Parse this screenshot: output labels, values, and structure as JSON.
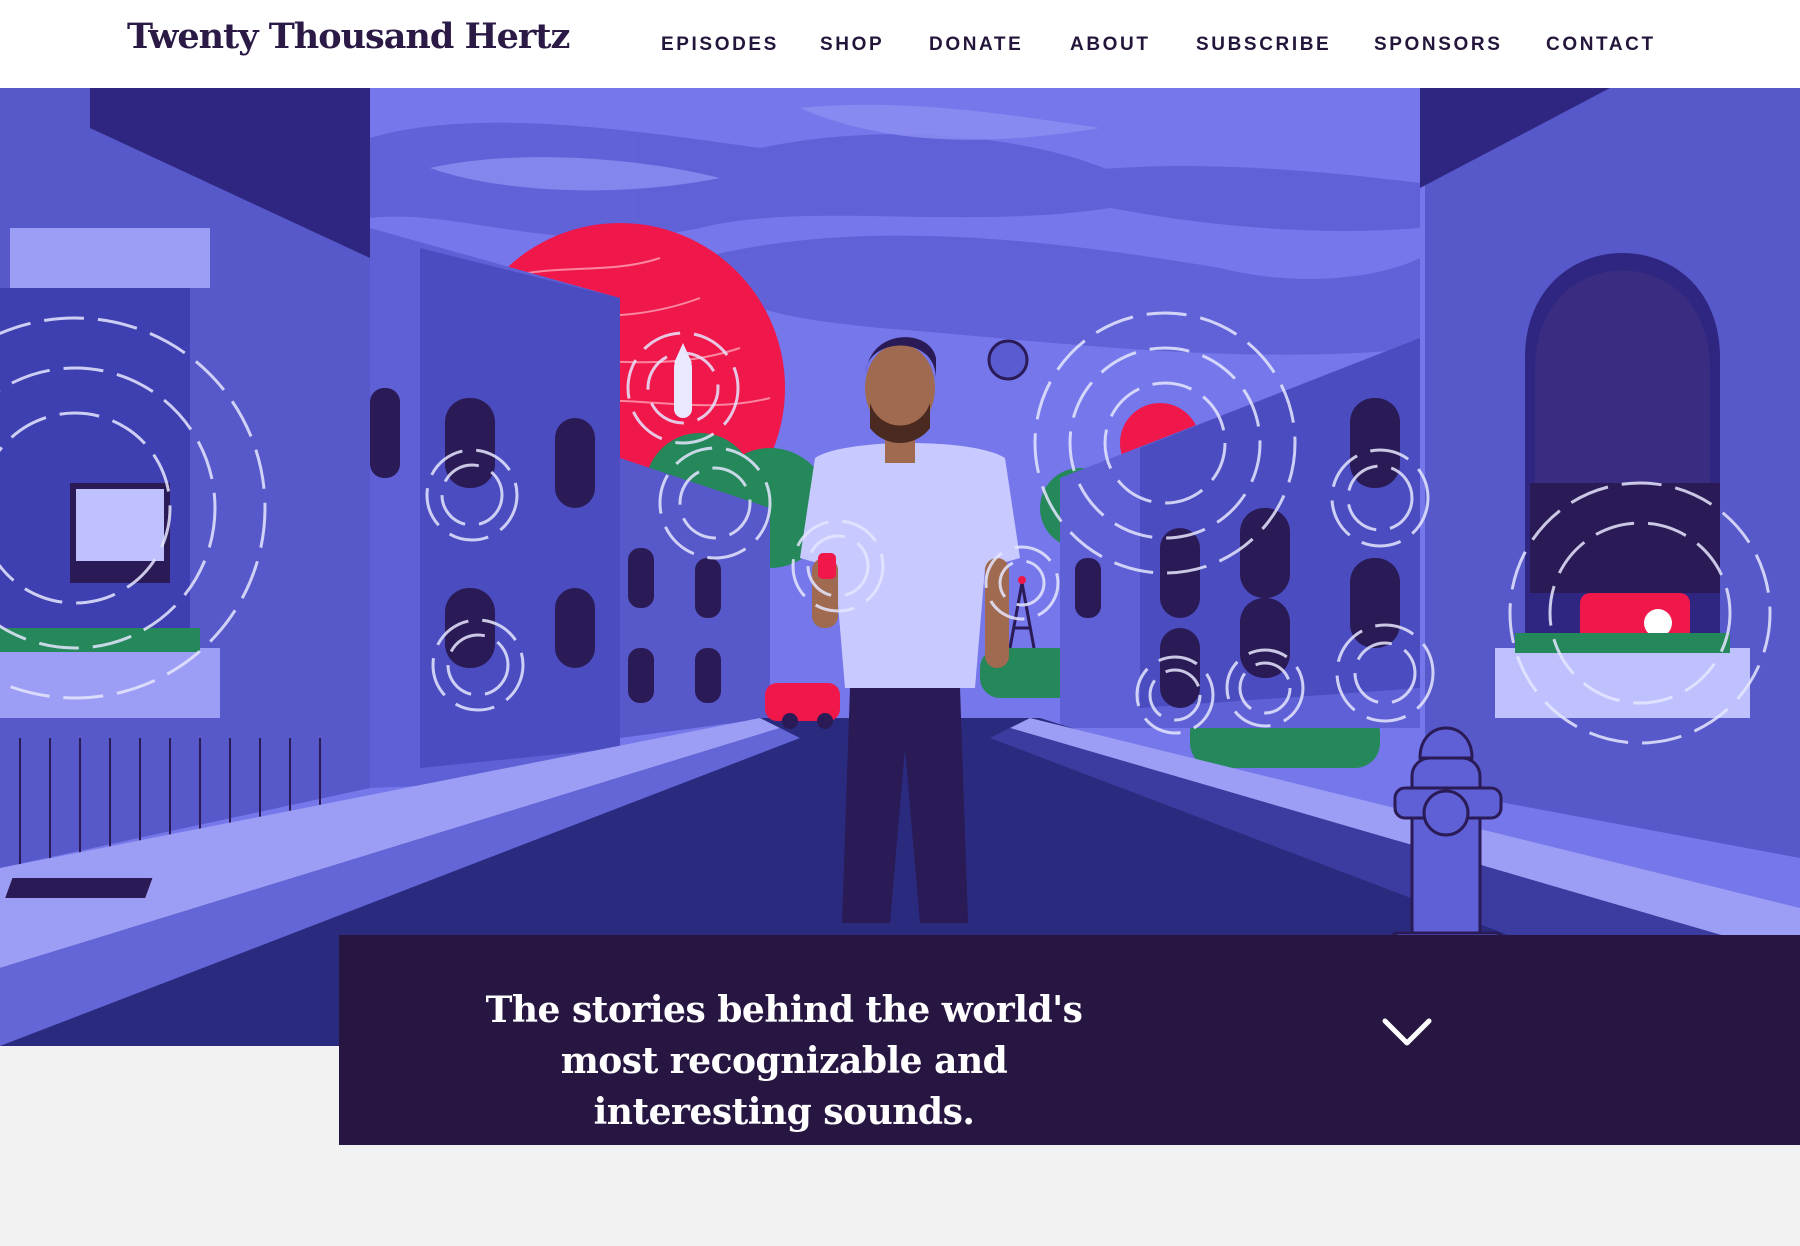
{
  "site": {
    "logo": "Twenty Thousand Hertz"
  },
  "nav": {
    "items": [
      {
        "label": "EPISODES"
      },
      {
        "label": "SHOP"
      },
      {
        "label": "DONATE"
      },
      {
        "label": "ABOUT"
      },
      {
        "label": "SUBSCRIBE"
      },
      {
        "label": "SPONSORS"
      },
      {
        "label": "CONTACT"
      }
    ]
  },
  "hero": {
    "illustration": "street-scene-illustration",
    "tagline": "The stories behind the world's most recognizable and interesting sounds."
  },
  "icons": {
    "scroll_down": "chevron-down-icon"
  },
  "colors": {
    "header_bg": "#ffffff",
    "text_dark": "#24163b",
    "hero_sky": "#7274ea",
    "hero_accent_red": "#f0174a",
    "tagline_bg": "#271641",
    "page_bg": "#f2f2f2"
  }
}
